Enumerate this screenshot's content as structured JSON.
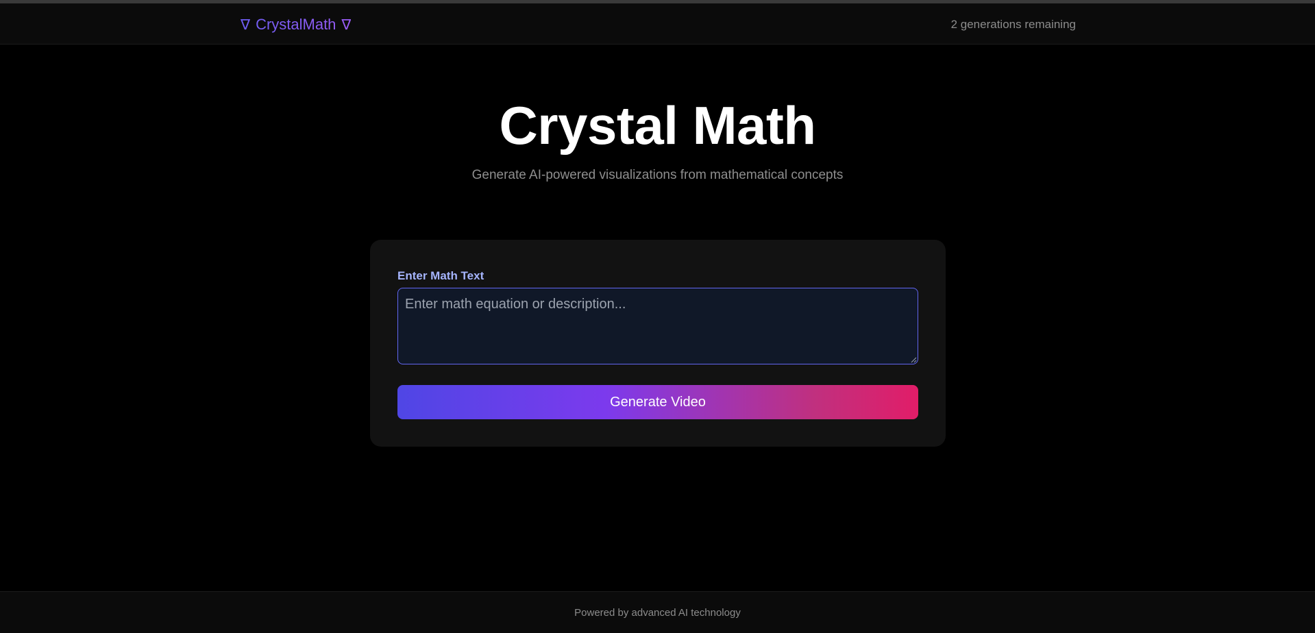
{
  "navbar": {
    "brand_prefix_icon": "nabla-icon",
    "brand_text": "CrystalMath",
    "brand_suffix_icon": "nabla-icon",
    "brand_symbol": "∇",
    "remaining_text": "2 generations remaining"
  },
  "hero": {
    "title": "Crystal Math",
    "subtitle": "Generate AI-powered visualizations from mathematical concepts"
  },
  "form": {
    "label": "Enter Math Text",
    "placeholder": "Enter math equation or description...",
    "value": "",
    "button_label": "Generate Video"
  },
  "footer": {
    "text": "Powered by advanced AI technology"
  },
  "colors": {
    "background": "#000000",
    "brand": "#8b5cf6",
    "label": "#a5b4fc",
    "input_border": "#6366f1",
    "button_gradient_start": "#4f46e5",
    "button_gradient_end": "#e11d68"
  }
}
